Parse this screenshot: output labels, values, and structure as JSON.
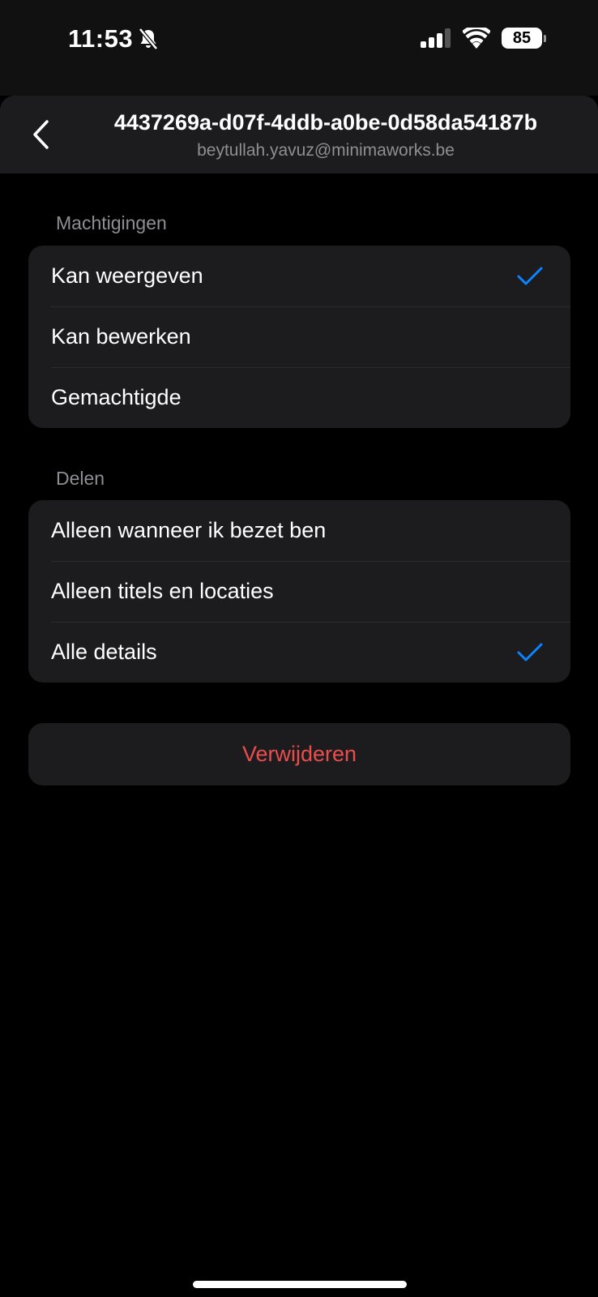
{
  "status_bar": {
    "time": "11:53",
    "battery": "85",
    "icons": [
      "bell-slash-icon",
      "signal-icon",
      "wifi-icon",
      "battery-icon"
    ]
  },
  "header": {
    "title": "4437269a-d07f-4ddb-a0be-0d58da54187b",
    "subtitle": "beytullah.yavuz@minimaworks.be",
    "back_icon": "chevron-left-icon"
  },
  "permissions": {
    "header": "Machtigingen",
    "items": [
      {
        "label": "Kan weergeven",
        "selected": true
      },
      {
        "label": "Kan bewerken",
        "selected": false
      },
      {
        "label": "Gemachtigde",
        "selected": false
      }
    ]
  },
  "sharing": {
    "header": "Delen",
    "items": [
      {
        "label": "Alleen wanneer ik bezet ben",
        "selected": false
      },
      {
        "label": "Alleen titels en locaties",
        "selected": false
      },
      {
        "label": "Alle details",
        "selected": true
      }
    ]
  },
  "delete_label": "Verwijderen",
  "colors": {
    "accent": "#0a84ff",
    "destructive": "#eb4d4d",
    "group_background": "#1c1c1e",
    "secondary_text": "#8e8e93"
  }
}
